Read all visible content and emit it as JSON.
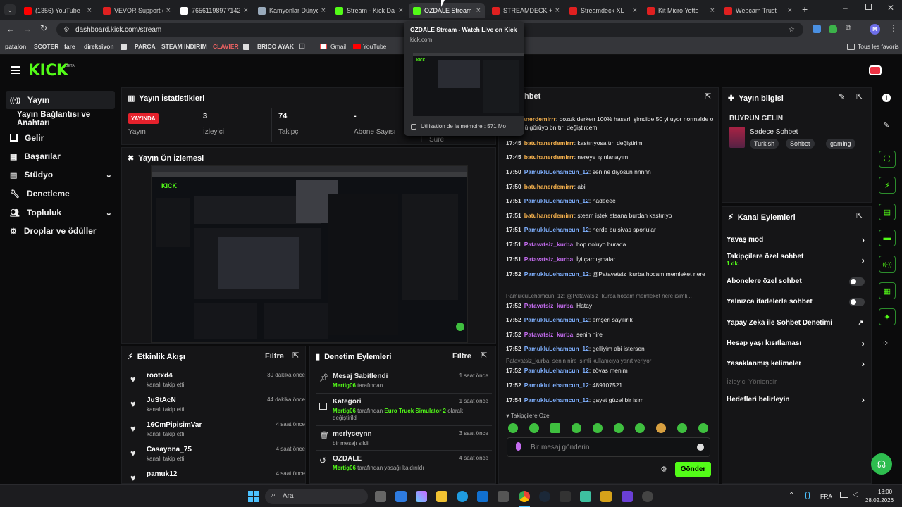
{
  "browser": {
    "tabs": [
      {
        "label": "(1356) YouTube",
        "fav": "#ff0000",
        "icon": "youtube-icon"
      },
      {
        "label": "VEVOR Support o",
        "fav": "#e02020",
        "icon": "vevor-icon"
      },
      {
        "label": "76561198977142...",
        "fav": "#ffffff",
        "icon": "google-icon"
      },
      {
        "label": "Kamyonlar Dünye",
        "fav": "#9ab",
        "icon": "image-icon"
      },
      {
        "label": "Stream - Kick Das",
        "fav": "#53fc18",
        "icon": "kick-icon"
      },
      {
        "label": "OZDALE Stream -",
        "fav": "#53fc18",
        "icon": "kick-icon"
      },
      {
        "label": "STREAMDECK + Re",
        "fav": "#e02020",
        "icon": "store-icon"
      },
      {
        "label": "Streamdeck XL",
        "fav": "#e02020",
        "icon": "store-icon"
      },
      {
        "label": "Kit Micro Yotto",
        "fav": "#e02020",
        "icon": "store-icon"
      },
      {
        "label": "Webcam Trust",
        "fav": "#e02020",
        "icon": "store-icon"
      }
    ],
    "url": "dashboard.kick.com/stream",
    "bookmarks": [
      "patalon",
      "SCOTER",
      "fare",
      "direksiyon",
      "PARCA",
      "STEAM INDIRIM",
      "CLAVIER",
      "BRICO AYAK",
      "Gmail",
      "YouTube"
    ],
    "all_bookmarks": "Tous les favoris",
    "profile": "M",
    "hover_card": {
      "title": "OZDALE Stream - Watch Live on Kick",
      "domain": "kick.com",
      "memory": "Utilisation de la mémoire : 571 Mo"
    }
  },
  "brand": {
    "logo": "KICK",
    "beta": "BETA",
    "accent": "#53fc18"
  },
  "sidebar": [
    {
      "label": "Yayın",
      "icon": "broadcast-icon",
      "active": true
    },
    {
      "label": "Yayın Bağlantısı ve Anahtarı"
    },
    {
      "label": "Gelir",
      "icon": "chart-icon"
    },
    {
      "label": "Başarılar",
      "icon": "grid-icon"
    },
    {
      "label": "Stüdyo",
      "icon": "studio-icon",
      "chev": true
    },
    {
      "label": "Denetleme",
      "icon": "wrench-icon"
    },
    {
      "label": "Topluluk",
      "icon": "users-icon",
      "chev": true
    },
    {
      "label": "Droplar ve ödüller",
      "icon": "gift-icon"
    }
  ],
  "stats": {
    "title": "Yayın İstatistikleri",
    "live_badge": "YAYINDA",
    "items": [
      {
        "value": "",
        "label": "Yayın"
      },
      {
        "value": "3",
        "label": "İzleyici"
      },
      {
        "value": "74",
        "label": "Takipçi"
      },
      {
        "value": "-",
        "label": "Abone Sayısı"
      },
      {
        "value": "",
        "label": "Süre"
      }
    ]
  },
  "preview": {
    "title": "Yayın Ön İzlemesi"
  },
  "activity": {
    "title": "Etkinlik Akışı",
    "filter": "Filtre",
    "items": [
      {
        "name": "rootxd4",
        "sub": "kanalı takip etti",
        "time": "39 dakika önce"
      },
      {
        "name": "JuStAcN",
        "sub": "kanalı takip etti",
        "time": "44 dakika önce"
      },
      {
        "name": "16CmPipisimVar",
        "sub": "kanalı takip etti",
        "time": "4 saat önce"
      },
      {
        "name": "Casayona_75",
        "sub": "kanalı takip etti",
        "time": "4 saat önce"
      },
      {
        "name": "pamuk12",
        "sub": "",
        "time": "4 saat önce"
      }
    ]
  },
  "moderation": {
    "title": "Denetim Eylemleri",
    "filter": "Filtre",
    "items": [
      {
        "name": "Mesaj Sabitlendi",
        "actor": "Mertig06",
        "rest": "tarafından",
        "time": "1 saat önce",
        "icon": "pin-icon"
      },
      {
        "name": "Kategori",
        "actor": "Mertig06",
        "rest": "tarafından",
        "extra": "Euro Truck Simulator 2",
        "rest2": "olarak değiştirildi",
        "time": "1 saat önce",
        "icon": "category-icon"
      },
      {
        "name": "merlyceynn",
        "actor": "",
        "rest": "bir mesajı sildi",
        "time": "3 saat önce",
        "icon": "trash-icon"
      },
      {
        "name": "OZDALE",
        "actor": "Mertig06",
        "rest": "tarafından yasağı kaldırıldı",
        "time": "4 saat önce",
        "icon": "undo-icon"
      }
    ]
  },
  "chat": {
    "title": "Sohbet",
    "lines": [
      {
        "time": "",
        "user": "batuhanerdemirrr",
        "c": "o",
        "msg": "bozuk derken 100% hasarlı şimdide 50 yi uyor normalde o tır 200 ü görüyo bn tırı değiştircem"
      },
      {
        "time": "17:45",
        "user": "batuhanerdemirrr",
        "c": "o",
        "msg": "kastırıyosa tırı değiştirim"
      },
      {
        "time": "17:45",
        "user": "batuhanerdemirrr",
        "c": "o",
        "msg": "nereye ışınlanayım"
      },
      {
        "time": "17:50",
        "user": "PamukluLehamcun_12",
        "c": "b",
        "msg": "sen ne diyosun nnnnn"
      },
      {
        "time": "17:50",
        "user": "batuhanerdemirrr",
        "c": "o",
        "msg": "abi"
      },
      {
        "time": "17:51",
        "user": "PamukluLehamcun_12",
        "c": "b",
        "msg": "hadeeee"
      },
      {
        "time": "17:51",
        "user": "batuhanerdemirrr",
        "c": "o",
        "msg": "steam istek atsana burdan kastırıyo"
      },
      {
        "time": "17:51",
        "user": "PamukluLehamcun_12",
        "c": "b",
        "msg": "nerde bu sivas sporlular"
      },
      {
        "time": "17:51",
        "user": "Patavatsiz_kurba",
        "c": "p",
        "msg": "hop noluyo burada"
      },
      {
        "time": "17:51",
        "user": "Patavatsiz_kurba",
        "c": "p",
        "msg": "İyi çarpışmalar"
      },
      {
        "time": "17:52",
        "user": "PamukluLehamcun_12",
        "c": "b",
        "msg": "@Patavatsiz_kurba hocam memleket nere"
      },
      {
        "time": "17:52",
        "user": "Patavatsiz_kurba",
        "c": "p",
        "msg": "Hatay",
        "reply": "PamukluLehamcun_12: @Patavatsiz_kurba hocam memleket nere isimli..."
      },
      {
        "time": "17:52",
        "user": "PamukluLehamcun_12",
        "c": "b",
        "msg": "emşeri sayılırık"
      },
      {
        "time": "17:52",
        "user": "Patavatsiz_kurba",
        "c": "p",
        "msg": "senin nire"
      },
      {
        "time": "17:52",
        "user": "PamukluLehamcun_12",
        "c": "b",
        "msg": "gelliyim abi istersen"
      },
      {
        "time": "17:52",
        "user": "PamukluLehamcun_12",
        "c": "b",
        "msg": "zövas menim",
        "reply": "Patavatsiz_kurba: senin nire isimli kullanıcıya yanıt veriyor"
      },
      {
        "time": "17:52",
        "user": "PamukluLehamcun_12",
        "c": "b",
        "msg": "489107521"
      },
      {
        "time": "17:54",
        "user": "PamukluLehamcun_12",
        "c": "b",
        "msg": "gayet güzel bir isim"
      }
    ],
    "followers_only": "Takipçilere Özel",
    "placeholder": "Bir mesaj gönderin",
    "send": "Gönder"
  },
  "stream_info": {
    "title": "Yayın bilgisi",
    "headline": "BUYRUN GELIN",
    "category": "Sadece Sohbet",
    "tags": [
      "Turkish",
      "Sohbet",
      "gaming"
    ]
  },
  "channel_actions": {
    "title": "Kanal Eylemleri",
    "items": [
      {
        "label": "Yavaş mod",
        "kind": "chev"
      },
      {
        "label": "Takipçilere özel sohbet",
        "sub": "1 dk.",
        "kind": "chev"
      },
      {
        "label": "Abonelere özel sohbet",
        "kind": "toggle"
      },
      {
        "label": "Yalnızca ifadelerle sohbet",
        "kind": "toggle"
      },
      {
        "label": "Yapay Zeka ile Sohbet Denetimi",
        "kind": "ext"
      },
      {
        "label": "Hesap yaşı kısıtlaması",
        "kind": "chev"
      },
      {
        "label": "Yasaklanmış kelimeler",
        "kind": "chev"
      },
      {
        "label": "İzleyici Yönlendir",
        "kind": "disabled"
      },
      {
        "label": "Hedefleri belirleyin",
        "kind": "chev"
      }
    ]
  },
  "taskbar": {
    "search": "Ara",
    "lang": "FRA",
    "time": "18:00",
    "date": "28.02.2026"
  }
}
